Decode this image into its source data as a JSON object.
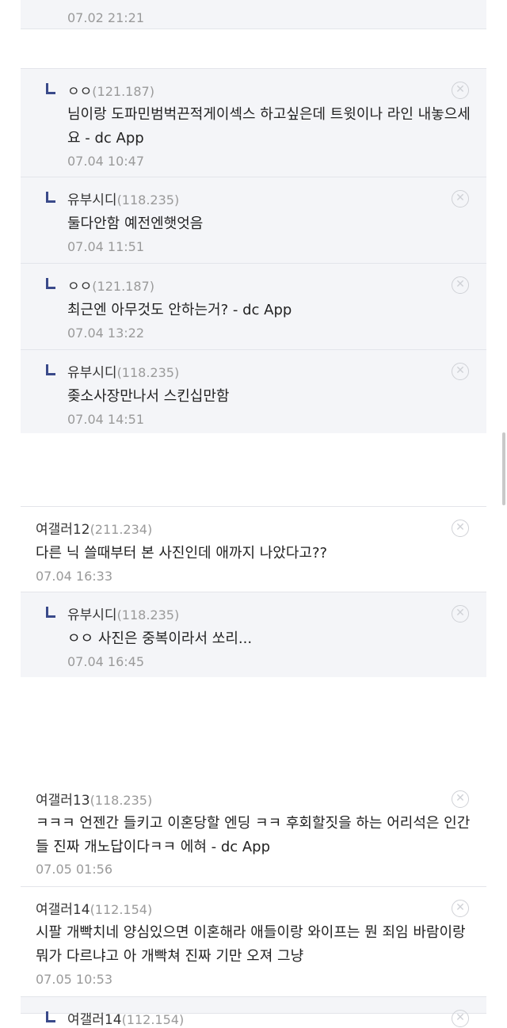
{
  "comments": [
    {
      "type": "reply",
      "time": "07.02 21:21"
    },
    {
      "type": "reply",
      "nick": "ㅇㅇ",
      "ip": "(121.187)",
      "text": "님이랑 도파민범벅끈적게이섹스 하고싶은데 트윗이나 라인 내놓으세요 - dc App",
      "time": "07.04 10:47"
    },
    {
      "type": "reply",
      "nick": "유부시디",
      "ip": "(118.235)",
      "text": "둘다안함 예전엔햇엇음",
      "time": "07.04 11:51"
    },
    {
      "type": "reply",
      "nick": "ㅇㅇ",
      "ip": "(121.187)",
      "text": "최근엔 아무것도 안하는거? - dc App",
      "time": "07.04 13:22"
    },
    {
      "type": "reply",
      "nick": "유부시디",
      "ip": "(118.235)",
      "text": "좆소사장만나서 스킨십만함",
      "time": "07.04 14:51"
    },
    {
      "type": "top",
      "nick": "여갤러12",
      "ip": "(211.234)",
      "text": "다른 닉 쓸때부터 본 사진인데 애까지 나았다고??",
      "time": "07.04 16:33"
    },
    {
      "type": "reply",
      "nick": "유부시디",
      "ip": "(118.235)",
      "text": "ㅇㅇ 사진은 중복이라서 쏘리...",
      "time": "07.04 16:45"
    },
    {
      "type": "top",
      "nick": "여갤러13",
      "ip": "(118.235)",
      "text": "ㅋㅋㅋ 언젠간 들키고 이혼당할 엔딩 ㅋㅋ 후회할짓을 하는 어리석은 인간들 진짜 개노답이다ㅋㅋ 에혀 - dc App",
      "time": "07.05 01:56"
    },
    {
      "type": "top",
      "nick": "여갤러14",
      "ip": "(112.154)",
      "text": "시팔 개빡치네 양심있으면 이혼해라 애들이랑 와이프는 뭔 죄임 바람이랑 뭐가 다르냐고 아 개빡쳐 진짜 기만 오져 그냥",
      "time": "07.05 10:53"
    },
    {
      "type": "reply",
      "nick": "여갤러14",
      "ip": "(112.154)"
    }
  ],
  "icons": {
    "delete": "close-circle-icon",
    "reply": "reply-arrow-icon"
  },
  "colors": {
    "reply_bg": "#f4f5f8",
    "reply_arrow": "#3a4a8a",
    "ip": "#9a9a9a",
    "divider": "#e3e5ea"
  }
}
